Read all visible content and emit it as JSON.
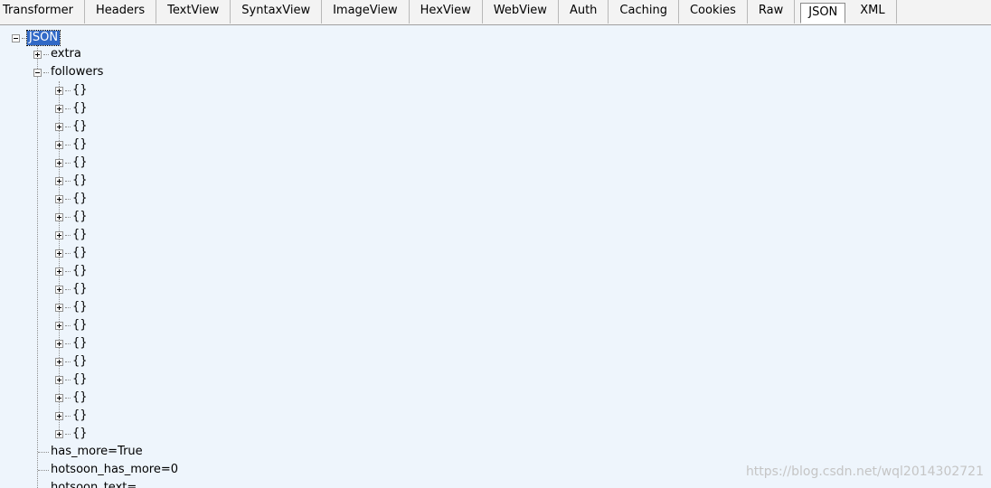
{
  "tabs": [
    {
      "id": "transformer",
      "label": "Transformer"
    },
    {
      "id": "headers",
      "label": "Headers"
    },
    {
      "id": "textview",
      "label": "TextView"
    },
    {
      "id": "syntaxview",
      "label": "SyntaxView"
    },
    {
      "id": "imageview",
      "label": "ImageView"
    },
    {
      "id": "hexview",
      "label": "HexView"
    },
    {
      "id": "webview",
      "label": "WebView"
    },
    {
      "id": "auth",
      "label": "Auth"
    },
    {
      "id": "caching",
      "label": "Caching"
    },
    {
      "id": "cookies",
      "label": "Cookies"
    },
    {
      "id": "raw",
      "label": "Raw"
    },
    {
      "id": "json",
      "label": "JSON",
      "selected": true
    },
    {
      "id": "xml",
      "label": "XML"
    }
  ],
  "tree": {
    "root_label": "JSON",
    "extra_label": "extra",
    "followers_label": "followers",
    "follower_item_label": "{}",
    "follower_count": 20,
    "leaves": [
      "has_more=True",
      "hotsoon_has_more=0",
      "hotsoon_text="
    ]
  },
  "watermark": "https://blog.csdn.net/wql2014302721"
}
